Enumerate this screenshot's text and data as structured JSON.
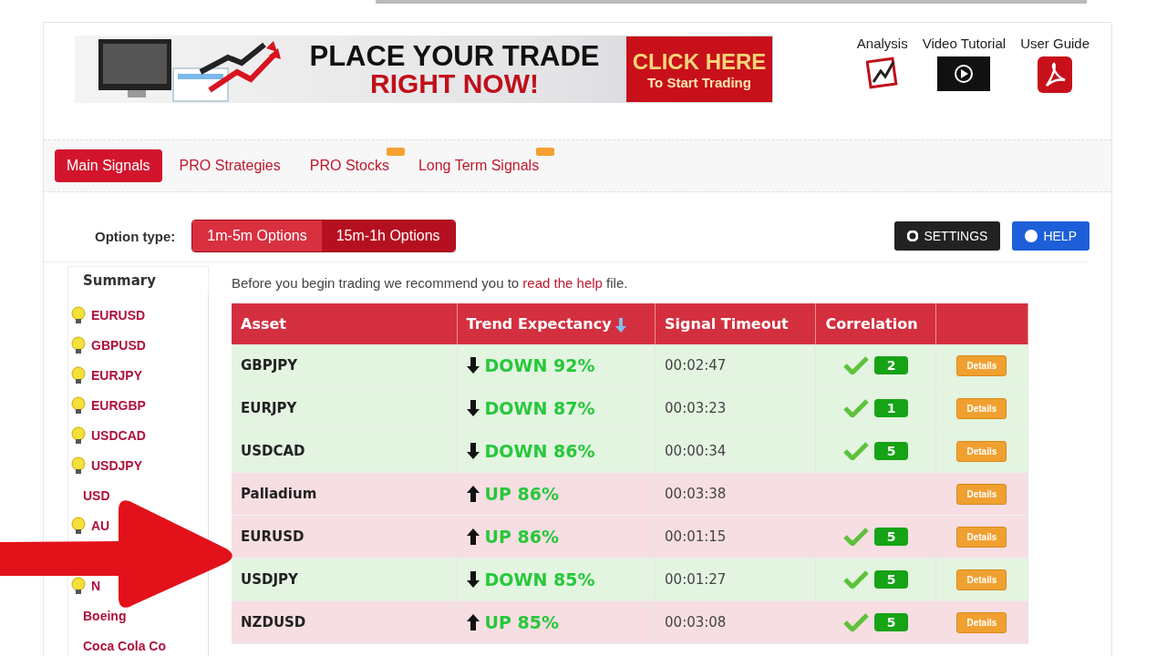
{
  "banner": {
    "headline_1": "PLACE YOUR TRADE",
    "headline_2": "RIGHT NOW!",
    "cta_1": "CLICK HERE",
    "cta_2": "To Start Trading"
  },
  "resources": [
    {
      "kind": "analysis",
      "label": "Analysis"
    },
    {
      "kind": "video",
      "label": "Video Tutorial"
    },
    {
      "kind": "pdf",
      "label": "User Guide"
    }
  ],
  "tabs": [
    {
      "label": "Main Signals",
      "selected": true,
      "new": false
    },
    {
      "label": "PRO Strategies",
      "selected": false,
      "new": false
    },
    {
      "label": "PRO Stocks",
      "selected": false,
      "new": true
    },
    {
      "label": "Long Term Signals",
      "selected": false,
      "new": true
    }
  ],
  "option_type": {
    "label": "Option type:",
    "options": [
      {
        "label": "1m-5m Options",
        "selected": false
      },
      {
        "label": "15m-1h Options",
        "selected": true
      }
    ]
  },
  "buttons": [
    {
      "kind": "settings",
      "label": "SETTINGS"
    },
    {
      "kind": "help",
      "label": "HELP"
    }
  ],
  "sidebar": {
    "title": "Summary",
    "items": [
      {
        "label": "EURUSD",
        "bulb": true
      },
      {
        "label": "GBPUSD",
        "bulb": true
      },
      {
        "label": "EURJPY",
        "bulb": true
      },
      {
        "label": "EURGBP",
        "bulb": true
      },
      {
        "label": "USDCAD",
        "bulb": true
      },
      {
        "label": "USDJPY",
        "bulb": true
      },
      {
        "label": "USD",
        "bulb": false
      },
      {
        "label": "AU",
        "bulb": true
      },
      {
        "label": "N",
        "bulb": true
      },
      {
        "label": "Boeing",
        "bulb": false
      },
      {
        "label": "Coca Cola Co",
        "bulb": false
      }
    ]
  },
  "intro": {
    "before": "Before you begin trading we recommend you to ",
    "link": "read the help",
    "after": " file."
  },
  "table": {
    "columns": [
      "Asset",
      "Trend Expectancy",
      "Signal Timeout",
      "Correlation"
    ],
    "rows": [
      {
        "asset": "GBPJPY",
        "kind": "down",
        "trend": "DOWN 92%",
        "timeout": "00:02:47",
        "correlation": "2",
        "details": "Details"
      },
      {
        "asset": "EURJPY",
        "kind": "down",
        "trend": "DOWN 87%",
        "timeout": "00:03:23",
        "correlation": "1",
        "details": "Details"
      },
      {
        "asset": "USDCAD",
        "kind": "down",
        "trend": "DOWN 86%",
        "timeout": "00:00:34",
        "correlation": "5",
        "details": "Details"
      },
      {
        "asset": "Palladium",
        "kind": "up",
        "trend": "UP 86%",
        "timeout": "00:03:38",
        "details": "Details"
      },
      {
        "asset": "EURUSD",
        "kind": "up",
        "trend": "UP 86%",
        "timeout": "00:01:15",
        "correlation": "5",
        "details": "Details"
      },
      {
        "asset": "USDJPY",
        "kind": "down",
        "trend": "DOWN 85%",
        "timeout": "00:01:27",
        "correlation": "5",
        "details": "Details"
      },
      {
        "asset": "NZDUSD",
        "kind": "up",
        "trend": "UP 85%",
        "timeout": "00:03:08",
        "correlation": "5",
        "details": "Details"
      }
    ]
  }
}
